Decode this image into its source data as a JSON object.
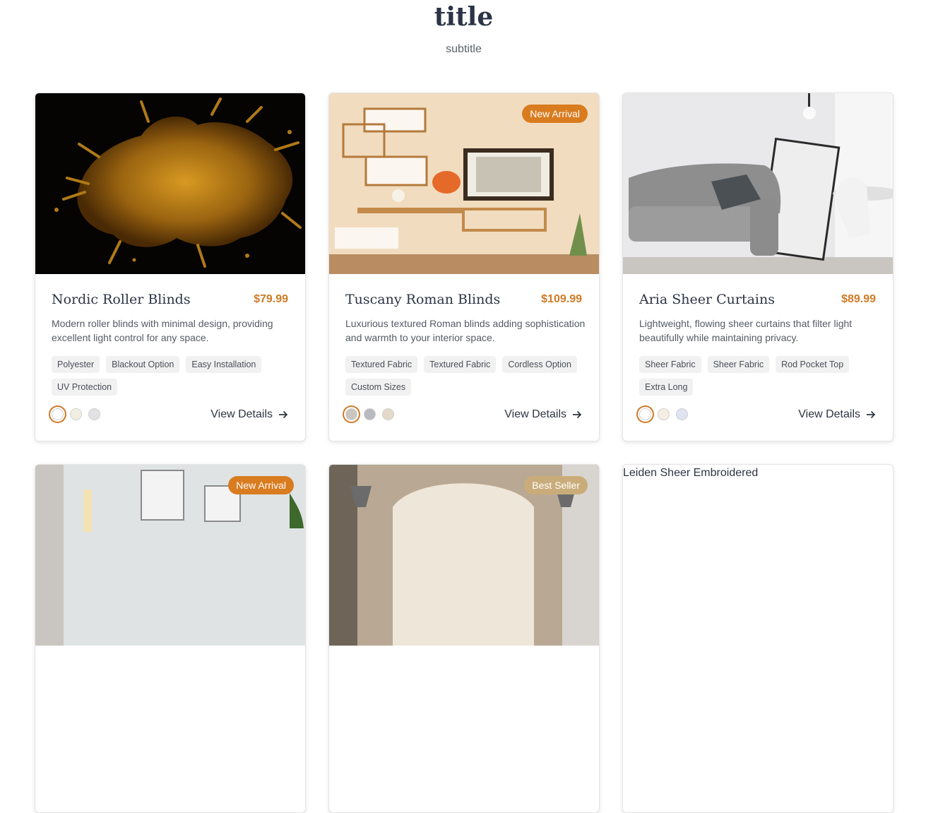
{
  "header": {
    "title": "title",
    "subtitle": "subtitle"
  },
  "accent_color": "#d07a25",
  "products": [
    {
      "name": "Nordic Roller Blinds",
      "price": "$79.99",
      "description": "Modern roller blinds with minimal design, providing excellent light control for any space.",
      "tags": [
        "Polyester",
        "Blackout Option",
        "Easy Installation",
        "UV Protection"
      ],
      "swatches": [
        "#ffffff",
        "#f1efe2",
        "#e2e2e4"
      ],
      "selected_swatch": 0,
      "cta": "View Details",
      "image": "gold-paint-splash"
    },
    {
      "name": "Tuscany Roman Blinds",
      "price": "$109.99",
      "description": "Luxurious textured Roman blinds adding sophistication and warmth to your interior space.",
      "tags": [
        "Textured Fabric",
        "Textured Fabric",
        "Cordless Option",
        "Custom Sizes"
      ],
      "swatches": [
        "#c9c6c0",
        "#b9babd",
        "#e4d8c9"
      ],
      "selected_swatch": 0,
      "badge": "New Arrival",
      "cta": "View Details",
      "image": "wall-shelves-living-room"
    },
    {
      "name": "Aria Sheer Curtains",
      "price": "$89.99",
      "description": "Lightweight, flowing sheer curtains that filter light beautifully while maintaining privacy.",
      "tags": [
        "Sheer Fabric",
        "Sheer Fabric",
        "Rod Pocket Top",
        "Extra Long"
      ],
      "swatches": [
        "#ffffff",
        "#f5efe3",
        "#dfe5f0"
      ],
      "selected_swatch": 0,
      "cta": "View Details",
      "image": "grey-sofa-room"
    },
    {
      "badge": "New Arrival",
      "image": "bedroom-curtains"
    },
    {
      "badge": "Best Seller",
      "image": "tufted-bed"
    },
    {
      "alt": "Leiden Sheer Embroidered"
    }
  ]
}
